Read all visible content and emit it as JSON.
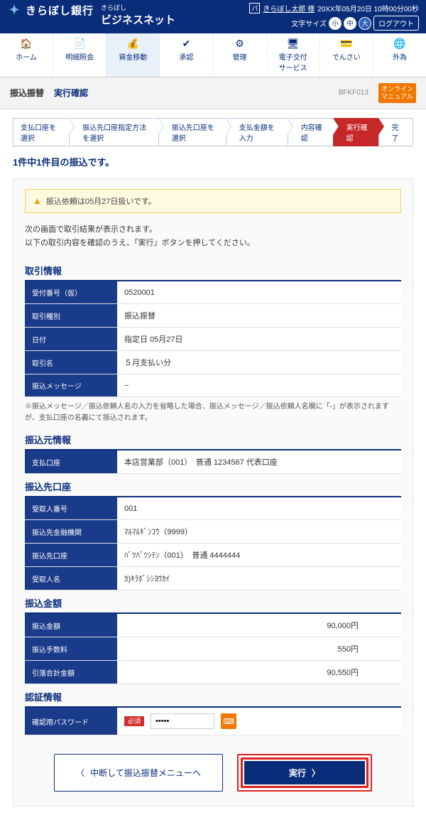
{
  "header": {
    "bank_name": "きらぼし銀行",
    "brand_small": "きらぼし",
    "brand_big": "ビジネスネット",
    "tp_label": "パ",
    "user_name": "きらぼし太郎 様",
    "datetime": "20XX年05月20日 10時00分00秒",
    "fontsize_label": "文字サイズ",
    "fs_small": "小",
    "fs_mid": "中",
    "fs_large": "大",
    "logout": "ログアウト"
  },
  "nav": [
    {
      "icon": "🏠",
      "label": "ホーム"
    },
    {
      "icon": "📄",
      "label": "明細照会"
    },
    {
      "icon": "💰",
      "label": "資金移動"
    },
    {
      "icon": "✔",
      "label": "承認"
    },
    {
      "icon": "⚙",
      "label": "管理"
    },
    {
      "icon": "🖥",
      "label": "電子交付\nサービス"
    },
    {
      "icon": "💳",
      "label": "でんさい"
    },
    {
      "icon": "🌐",
      "label": "外為"
    }
  ],
  "pagebar": {
    "cat": "振込振替",
    "sub": "実行確認",
    "code": "BFKF013",
    "help": "オンライン\nマニュアル"
  },
  "steps": [
    "支払口座を選択",
    "振込先口座指定方法を選択",
    "振込先口座を選択",
    "支払金額を入力",
    "内容確認",
    "実行確認",
    "完了"
  ],
  "active_step": 5,
  "count_title": "1件中1件目の振込です。",
  "alert_text": "振込依頼は05月27日扱いです。",
  "desc_l1": "次の画面で取引結果が表示されます。",
  "desc_l2": "以下の取引内容を確認のうえ、「実行」ボタンを押してください。",
  "sections": {
    "trade": {
      "title": "取引情報",
      "rows": [
        {
          "k": "受付番号（仮）",
          "v": "0520001"
        },
        {
          "k": "取引種別",
          "v": "振込振替"
        },
        {
          "k": "日付",
          "v": "指定日 05月27日"
        },
        {
          "k": "取引名",
          "v": "５月支払い分"
        },
        {
          "k": "振込メッセージ",
          "v": "−"
        }
      ],
      "note": "※振込メッセージ／振込依頼人名の入力を省略した場合、振込メッセージ／振込依頼人名欄に「-」が表示されますが、支払口座の名義にて振込されます。"
    },
    "from": {
      "title": "振込元情報",
      "rows": [
        {
          "k": "支払口座",
          "v": "本店営業部（001）　普通 1234567 代表口座"
        }
      ]
    },
    "to": {
      "title": "振込先口座",
      "rows": [
        {
          "k": "受取人番号",
          "v": "001"
        },
        {
          "k": "振込先金融機関",
          "v": "ﾏﾙﾏﾙｷﾞﾝｺｳ（9999）"
        },
        {
          "k": "振込先口座",
          "v": "ﾊﾞﾂﾊﾞﾂｼﾃﾝ（001）　普通 4444444"
        },
        {
          "k": "受取人名",
          "v": "ｶ)ｷﾗﾎﾞｼｼﾖｳｶｲ"
        }
      ]
    },
    "amount": {
      "title": "振込金額",
      "rows": [
        {
          "k": "振込金額",
          "v": "90,000円"
        },
        {
          "k": "振込手数料",
          "v": "550円"
        },
        {
          "k": "引落合計金額",
          "v": "90,550円"
        }
      ]
    },
    "auth": {
      "title": "認証情報",
      "pwd_label": "確認用パスワード",
      "req": "必須",
      "pwd_value": "•••••"
    }
  },
  "buttons": {
    "back": "中断して振込振替メニューへ",
    "exec": "実行"
  }
}
